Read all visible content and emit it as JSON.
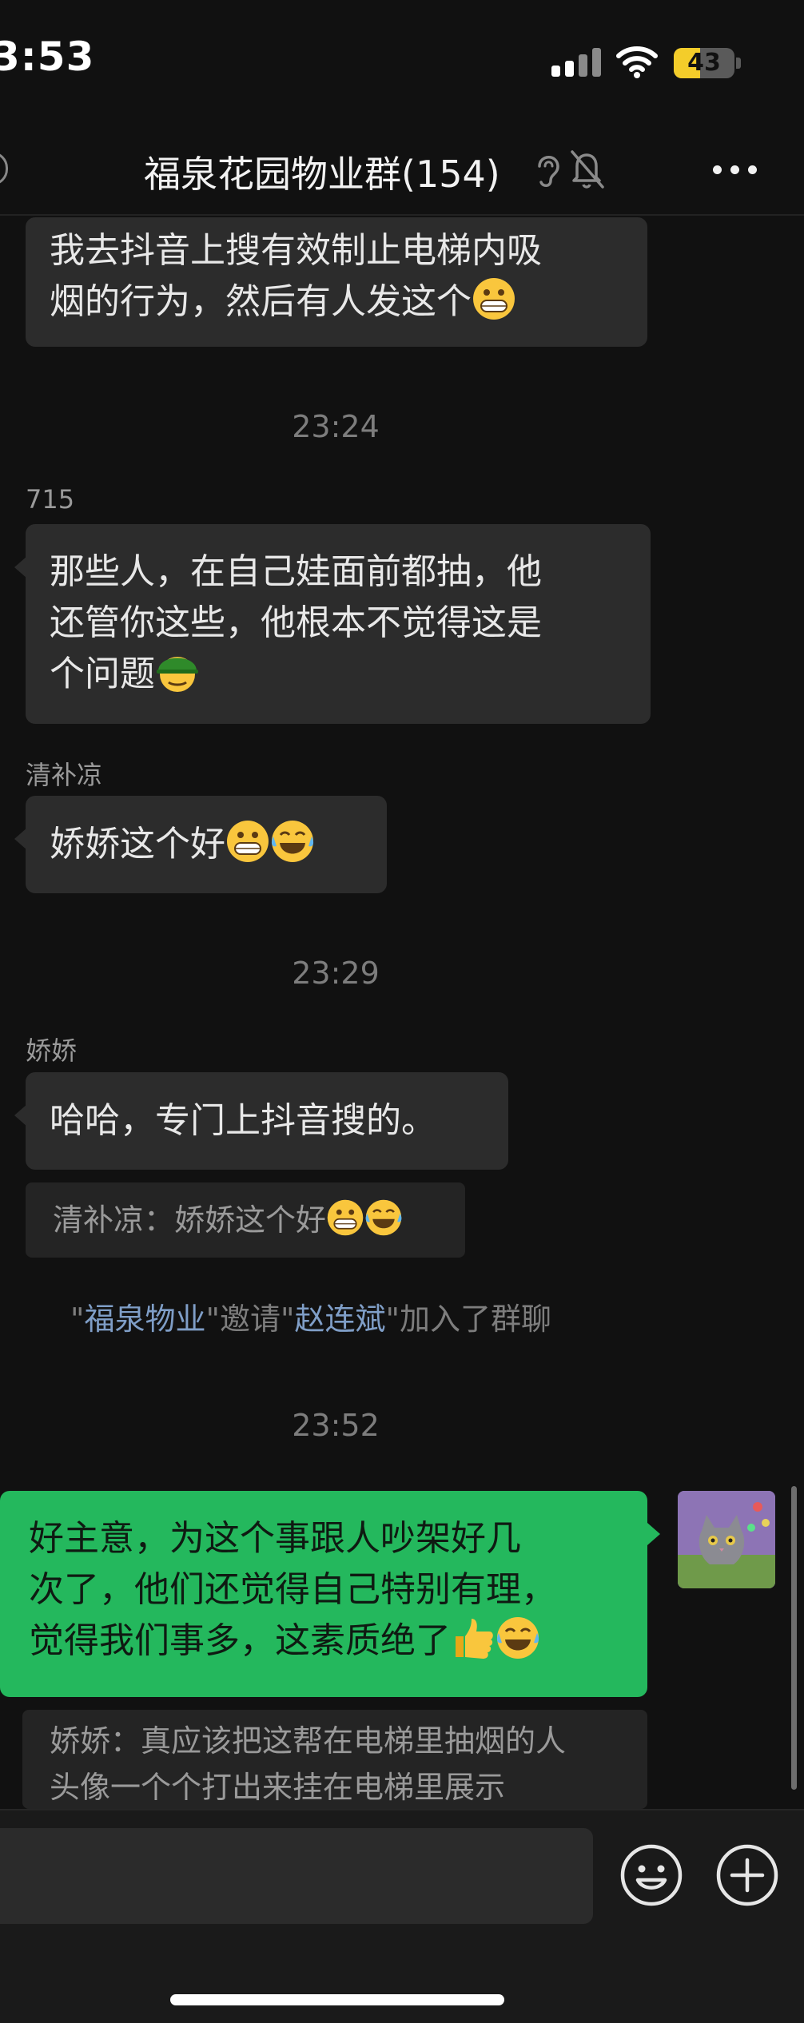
{
  "status_bar": {
    "time": "3:53",
    "battery": "43"
  },
  "header": {
    "title": "福泉花园物业群(154)"
  },
  "messages": {
    "m1": {
      "line1": "我去抖音上搜有效制止电梯内吸",
      "line2": "烟的行为，然后有人发这个"
    },
    "t1": "23:24",
    "m2": {
      "sender": "715",
      "line1": "那些人，在自己娃面前都抽，他",
      "line2": "还管你这些，他根本不觉得这是",
      "line3": "个问题"
    },
    "m3": {
      "sender": "清补凉",
      "text": "娇娇这个好"
    },
    "t2": "23:29",
    "m4": {
      "sender": "娇娇",
      "text": "哈哈，专门上抖音搜的。",
      "quote": "清补凉：娇娇这个好"
    },
    "sys": {
      "q1": "\"",
      "name1": "福泉物业",
      "mid": "\"邀请\"",
      "name2": "赵连斌",
      "tail": "\"加入了群聊"
    },
    "t3": "23:52",
    "m5": {
      "line1": "好主意，为这个事跟人吵架好几",
      "line2": "次了，他们还觉得自己特别有理，",
      "line3": "觉得我们事多，这素质绝了",
      "quote_line1": "娇娇：真应该把这帮在电梯里抽烟的人",
      "quote_line2": "头像一个个打出来挂在电梯里展示"
    }
  },
  "icons": [
    "ear-icon",
    "mute-bell-icon",
    "more-icon",
    "grin-emoji",
    "tears-of-joy-emoji",
    "helmet-emoji",
    "thumbs-up-emoji",
    "sticker-emoji-icon",
    "plus-circle-icon"
  ],
  "colors": {
    "background": "#111111",
    "bubble": "#2c2c2c",
    "self_bubble": "#24b85d",
    "link": "#7f9ec7",
    "battery": "#f4cd2a"
  }
}
